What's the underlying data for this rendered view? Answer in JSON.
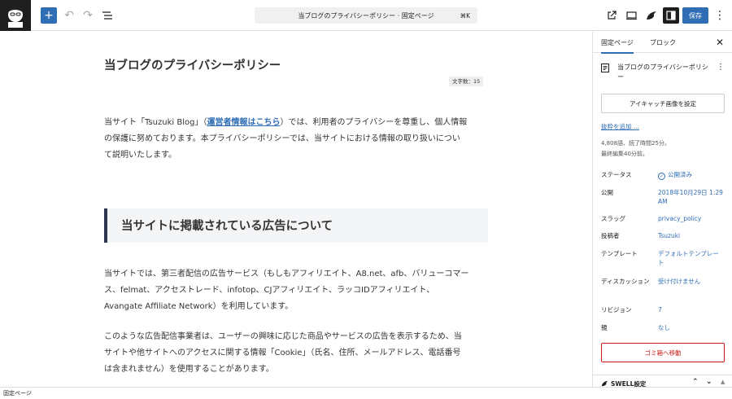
{
  "toolbar": {
    "command_title": "当ブログのプライバシーポリシー · 固定ページ",
    "command_shortcut": "⌘K",
    "save_label": "保存"
  },
  "document": {
    "title": "当ブログのプライバシーポリシー",
    "word_count": "文字数：15",
    "intro_prefix": "当サイト「Tsuzuki Blog」（",
    "intro_link": "運営者情報はこちら",
    "intro_line1_rest": "）では、利用者のプライバシーを尊重し、個人情報",
    "intro_line2": "の保護に努めております。本プライバシーポリシーでは、当サイトにおける情報の取り扱いについ",
    "intro_line3": "て説明いたします。",
    "heading": "当サイトに掲載されている広告について",
    "ad_line1": "当サイトでは、第三者配信の広告サービス（もしもアフィリエイト、A8.net、afb、バリューコマー",
    "ad_line2": "ス、felmat、アクセストレード、infotop、CJアフィリエイト、ラッコIDアフィリエイト、",
    "ad_line3": "Avangate Affiliate Network）を利用しています。",
    "cookie_line1": "このような広告配信事業者は、ユーザーの興味に応じた商品やサービスの広告を表示するため、当",
    "cookie_line2": "サイトや他サイトへのアクセスに関する情報「Cookie」（氏名、住所、メールアドレス、電話番号",
    "cookie_line3": "は含まれません）を使用することがあります。"
  },
  "sidebar": {
    "tab_page": "固定ページ",
    "tab_block": "ブロック",
    "page_title": "当ブログのプライバシーポリシー",
    "featured_image_button": "アイキャッチ画像を設定",
    "add_excerpt": "抜粋を追加 ...",
    "meta_line1": "4,808語、読了時間25分。",
    "meta_line2": "最終編集40分前。",
    "rows": [
      {
        "label": "ステータス",
        "value": "公開済み"
      },
      {
        "label": "公開",
        "value": "2018年10月29日 1:29 AM"
      },
      {
        "label": "スラッグ",
        "value": "privacy_policy"
      },
      {
        "label": "投稿者",
        "value": "Tsuzuki"
      },
      {
        "label": "テンプレート",
        "value": "デフォルトテンプレート"
      },
      {
        "label": "ディスカッション",
        "value": "受け付けません"
      },
      {
        "label": "リビジョン",
        "value": "7"
      },
      {
        "label": "親",
        "value": "なし"
      }
    ],
    "trash_button": "ゴミ箱へ移動",
    "swell_settings": "SWELL設定"
  },
  "statusbar": {
    "breadcrumb": "固定ページ"
  },
  "colors": {
    "accent": "#2f6db5",
    "danger": "#cc1818",
    "heading_bar": "#2c3650"
  }
}
